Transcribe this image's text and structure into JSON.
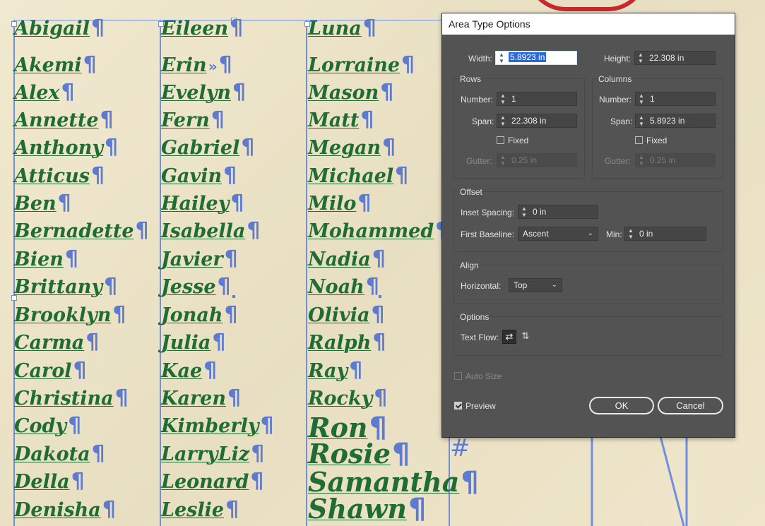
{
  "canvas": {
    "columns": [
      {
        "names": [
          "Abigail",
          "Akemi",
          "Alex",
          "Annette",
          "Anthony",
          "Atticus",
          "Ben",
          "Bernadette",
          "Bien",
          "Brittany",
          "Brooklyn",
          "Carma",
          "Carol",
          "Christina",
          "Cody",
          "Dakota",
          "Della",
          "Denisha"
        ]
      },
      {
        "names": [
          "Eileen",
          "Erin",
          "Evelyn",
          "Fern",
          "Gabriel",
          "Gavin",
          "Hailey",
          "Isabella",
          "Javier",
          "Jesse",
          "Jonah",
          "Julia",
          "Kae",
          "Karen",
          "Kimberly",
          "LarryLiz",
          "Leonard",
          "Leslie"
        ]
      },
      {
        "names": [
          "Luna",
          "Lorraine",
          "Mason",
          "Matt",
          "Megan",
          "Michael",
          "Milo",
          "Mohammed",
          "Nadia",
          "Noah",
          "Olivia",
          "Ralph",
          "Ray",
          "Rocky",
          "Ron",
          "Rosie",
          "Samantha",
          "Shawn"
        ]
      }
    ],
    "pilcrow": "¶",
    "overflow_mark": "»",
    "hash_mark": "#"
  },
  "dialog": {
    "title": "Area Type Options",
    "width_label": "Width:",
    "width_value": "5.8923 in",
    "height_label": "Height:",
    "height_value": "22.308 in",
    "rows": {
      "title": "Rows",
      "number_label": "Number:",
      "number_value": "1",
      "span_label": "Span:",
      "span_value": "22.308 in",
      "fixed_label": "Fixed",
      "gutter_label": "Gutter:",
      "gutter_value": "0.25 in"
    },
    "columns": {
      "title": "Columns",
      "number_label": "Number:",
      "number_value": "1",
      "span_label": "Span:",
      "span_value": "5.8923 in",
      "fixed_label": "Fixed",
      "gutter_label": "Gutter:",
      "gutter_value": "0.25 in"
    },
    "offset": {
      "title": "Offset",
      "inset_label": "Inset Spacing:",
      "inset_value": "0 in",
      "baseline_label": "First Baseline:",
      "baseline_value": "Ascent",
      "min_label": "Min:",
      "min_value": "0 in"
    },
    "align": {
      "title": "Align",
      "horizontal_label": "Horizontal:",
      "horizontal_value": "Top"
    },
    "options": {
      "title": "Options",
      "text_flow_label": "Text Flow:"
    },
    "auto_size_label": "Auto Size",
    "preview_label": "Preview",
    "preview_checked": true,
    "ok_label": "OK",
    "cancel_label": "Cancel"
  }
}
